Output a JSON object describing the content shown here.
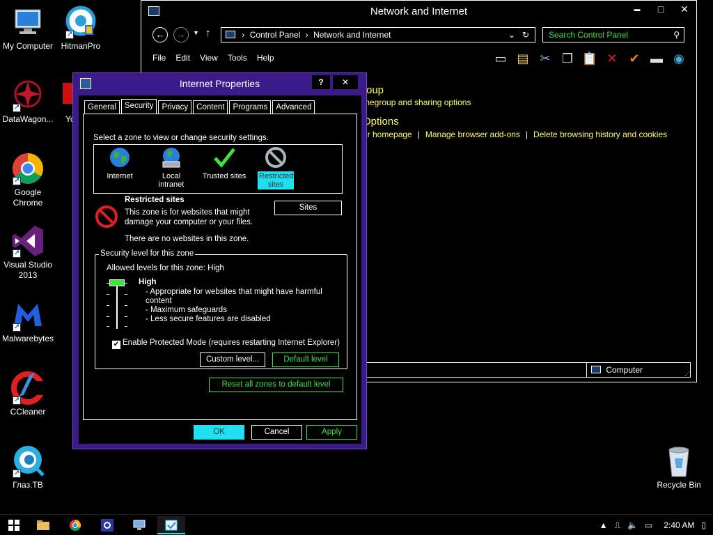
{
  "desktop": {
    "icons": [
      {
        "label": "My Computer",
        "icon": "computer-icon"
      },
      {
        "label": "HitmanPro",
        "icon": "hitmanpro-icon"
      },
      {
        "label": "DataWagon...",
        "icon": "datawagon-icon"
      },
      {
        "label": "Yo",
        "icon": "app-icon"
      },
      {
        "label": "Google Chrome",
        "icon": "chrome-icon"
      },
      {
        "label": "Visual Studio 2013",
        "icon": "visual-studio-icon"
      },
      {
        "label": "Malwarebytes",
        "icon": "malwarebytes-icon"
      },
      {
        "label": "CCleaner",
        "icon": "ccleaner-icon"
      },
      {
        "label": "Глаз.ТВ",
        "icon": "glaz-tv-icon"
      },
      {
        "label": "Recycle Bin",
        "icon": "recycle-bin-icon"
      }
    ]
  },
  "control_panel": {
    "title": "Network and Internet",
    "window_controls": {
      "minimize": "▬",
      "maximize": "□",
      "close": "✕"
    },
    "breadcrumb": [
      "Control Panel",
      "Network and Internet"
    ],
    "search_placeholder": "Search Control Panel",
    "menu": [
      "File",
      "Edit",
      "View",
      "Tools",
      "Help"
    ],
    "heading1": "roup",
    "link1": "megroup and sharing options",
    "heading2": "Options",
    "links2": [
      "ur homepage",
      "Manage browser add-ons",
      "Delete browsing history and cookies"
    ],
    "status_computer": "Computer"
  },
  "dialog": {
    "title": "Internet Properties",
    "help_btn": "?",
    "close_btn": "✕",
    "tabs": [
      "General",
      "Security",
      "Privacy",
      "Content",
      "Programs",
      "Advanced"
    ],
    "zone_prompt": "Select a zone to view or change security settings.",
    "zones": [
      {
        "label": "Internet"
      },
      {
        "label": "Local intranet"
      },
      {
        "label": "Trusted sites"
      },
      {
        "label": "Restricted sites"
      }
    ],
    "selected_zone_title": "Restricted sites",
    "selected_zone_desc": "This zone is for websites that might damage your computer or your files.",
    "no_sites": "There are no websites in this zone.",
    "sites_btn": "Sites",
    "security_level_legend": "Security level for this zone",
    "allowed_levels": "Allowed levels for this zone: High",
    "level_name": "High",
    "level_desc": [
      "- Appropriate for websites that might have harmful content",
      "- Maximum safeguards",
      "- Less secure features are disabled"
    ],
    "protected_mode": "Enable Protected Mode (requires restarting Internet Explorer)",
    "protected_mode_checked": true,
    "custom_level_btn": "Custom level...",
    "default_level_btn": "Default level",
    "reset_btn": "Reset all zones to default level",
    "ok_btn": "OK",
    "cancel_btn": "Cancel",
    "apply_btn": "Apply"
  },
  "taskbar": {
    "items": [
      "start-icon",
      "file-explorer-icon",
      "chrome-icon",
      "settings-icon",
      "network-icon",
      "internet-options-icon"
    ],
    "clock": "2:40 AM"
  },
  "colors": {
    "accent_green": "#3fe03f",
    "accent_yellow": "#ffff66",
    "accent_cyan": "#1ee0f0",
    "dialog_frame": "#3b1a8a"
  }
}
